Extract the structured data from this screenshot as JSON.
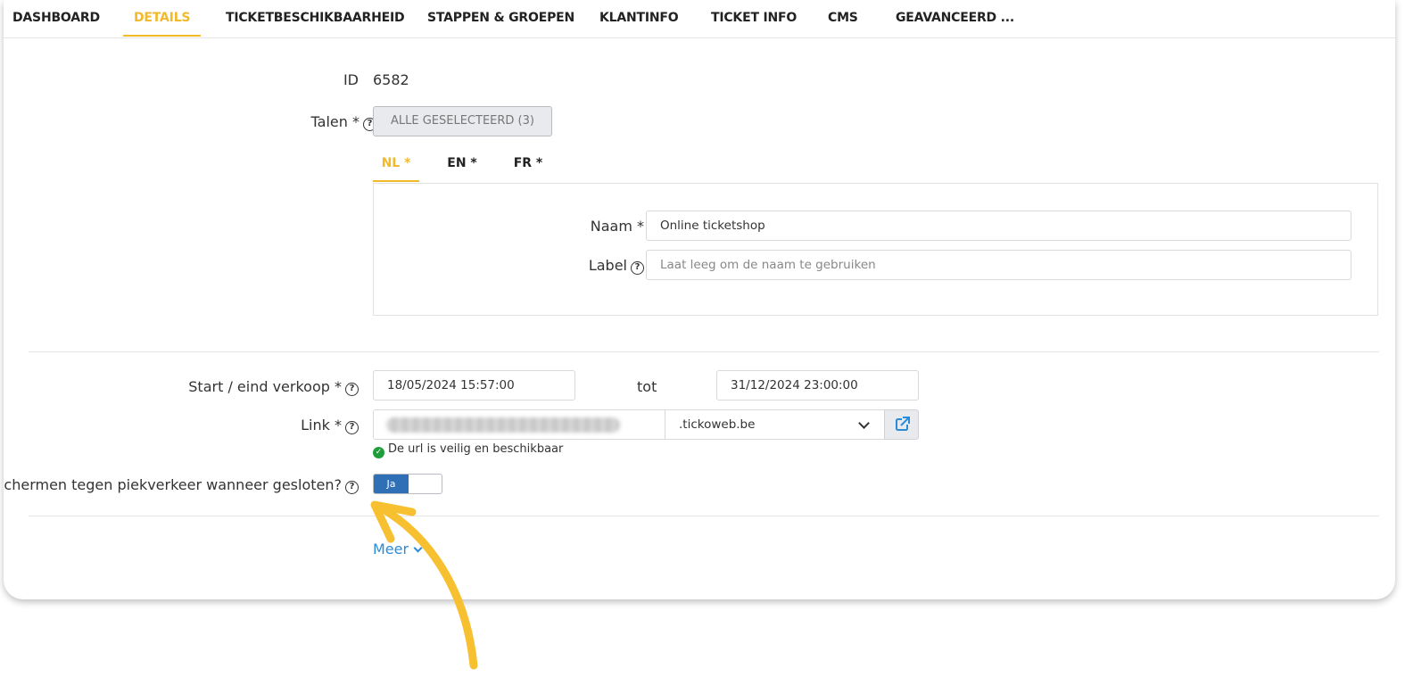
{
  "tabs": [
    {
      "label": "DASHBOARD"
    },
    {
      "label": "DETAILS"
    },
    {
      "label": "TICKETBESCHIKBAARHEID"
    },
    {
      "label": "STAPPEN & GROEPEN"
    },
    {
      "label": "KLANTINFO"
    },
    {
      "label": "TICKET INFO"
    },
    {
      "label": "CMS"
    },
    {
      "label": "GEAVANCEERD ..."
    }
  ],
  "active_tab": "DETAILS",
  "form": {
    "id_label": "ID",
    "id_value": "6582",
    "talen_label": "Talen *",
    "talen_button": "ALLE GESELECTEERD (3)",
    "lang_tabs": [
      "NL *",
      "EN *",
      "FR *"
    ],
    "naam_label": "Naam *",
    "naam_value": "Online ticketshop",
    "label_label": "Label",
    "label_placeholder": "Laat leeg om de naam te gebruiken",
    "verkoop_label": "Start / eind verkoop *",
    "start_value": "18/05/2024 15:57:00",
    "tot_label": "tot",
    "end_value": "31/12/2024 23:00:00",
    "link_label": "Link *",
    "domain_value": ".tickoweb.be",
    "url_status": "De url is veilig en beschikbaar",
    "piek_label": "Beschermen tegen piekverkeer wanneer gesloten?",
    "toggle_on_label": "Ja",
    "more_label": "Meer"
  },
  "colors": {
    "accent": "#f2b92b",
    "toggle_on": "#2f6fb5",
    "link": "#2a8bd8",
    "success": "#1f9d3a"
  },
  "icons": {
    "help": "question-circle-icon",
    "external": "external-link-icon",
    "chevron": "chevron-down-icon",
    "check": "check-circle-icon"
  }
}
